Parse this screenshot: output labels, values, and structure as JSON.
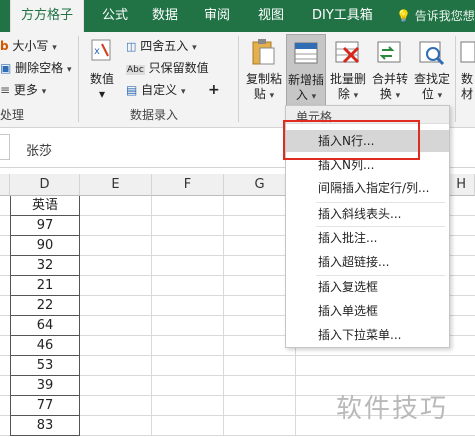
{
  "tabs": [
    "方方格子",
    "公式",
    "数据",
    "审阅",
    "视图",
    "DIY工具箱"
  ],
  "tell_me": "告诉我您想",
  "ribbon": {
    "text_group": {
      "case_label": "大小写",
      "remove_space_label": "删除空格",
      "more_label": "更多",
      "group_label": "处理"
    },
    "number_group": {
      "number_btn": "数值",
      "round_label": "四舍五入",
      "keep_value_label": "只保留数值",
      "custom_label": "自定义",
      "plus": "+",
      "group_label": "数据录入"
    },
    "buttons": [
      {
        "line1": "复制粘",
        "line2": "贴"
      },
      {
        "line1": "新增插",
        "line2": "入"
      },
      {
        "line1": "批量删",
        "line2": "除"
      },
      {
        "line1": "合并转",
        "line2": "换"
      },
      {
        "line1": "查找定",
        "line2": "位"
      },
      {
        "line1": "数",
        "line2": "材"
      }
    ]
  },
  "formula_bar": {
    "value": "张莎"
  },
  "grid": {
    "columns": [
      "D",
      "E",
      "F",
      "G",
      "H"
    ],
    "header": "英语",
    "values": [
      "97",
      "90",
      "32",
      "21",
      "22",
      "64",
      "46",
      "53",
      "39",
      "77",
      "83"
    ]
  },
  "menu": {
    "section": "单元格",
    "items": [
      "插入N行...",
      "插入N列...",
      "间隔插入指定行/列...",
      "插入斜线表头...",
      "插入批注...",
      "插入超链接...",
      "插入复选框",
      "插入单选框",
      "插入下拉菜单..."
    ]
  },
  "watermark": "软件技巧",
  "colors": {
    "excel_green": "#217346",
    "highlight_red": "#e02b20"
  }
}
